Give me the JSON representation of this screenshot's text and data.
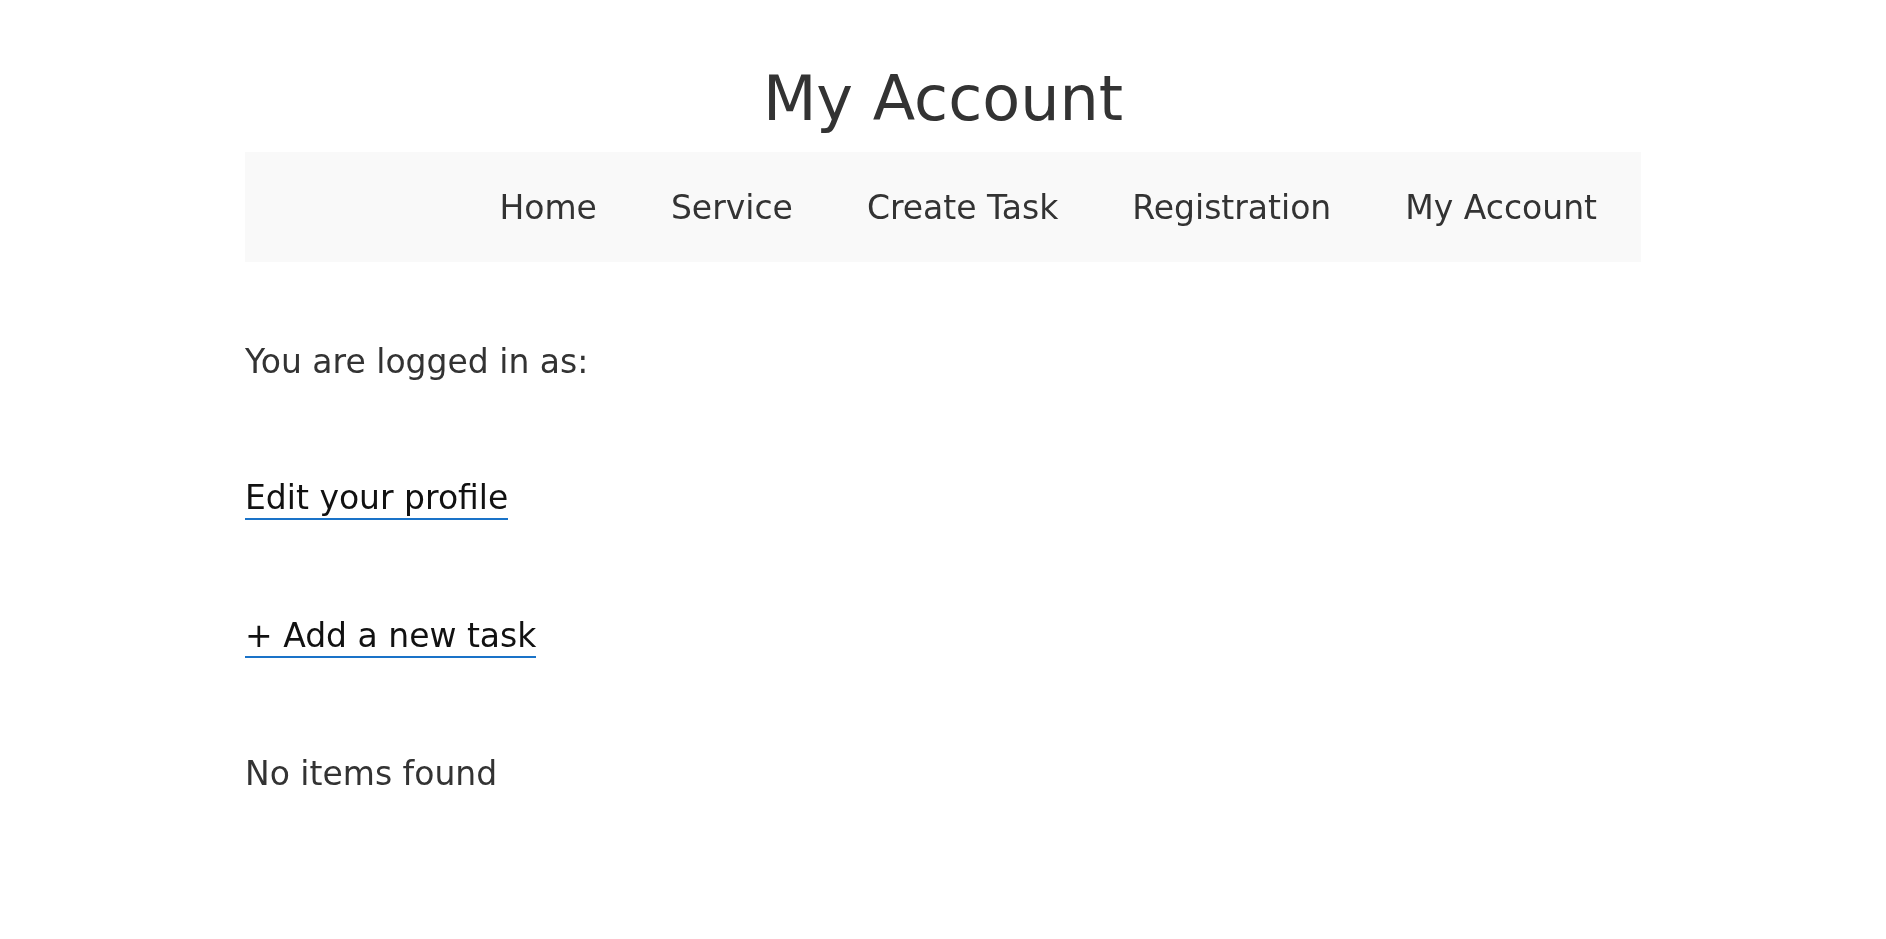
{
  "page_title": "My Account",
  "nav": {
    "items": [
      "Home",
      "Service",
      "Create Task",
      "Registration",
      "My Account"
    ]
  },
  "login_status": "You are logged in as:",
  "links": [
    "Edit your profile",
    "+ Add a new task"
  ],
  "empty_message": "No items found"
}
